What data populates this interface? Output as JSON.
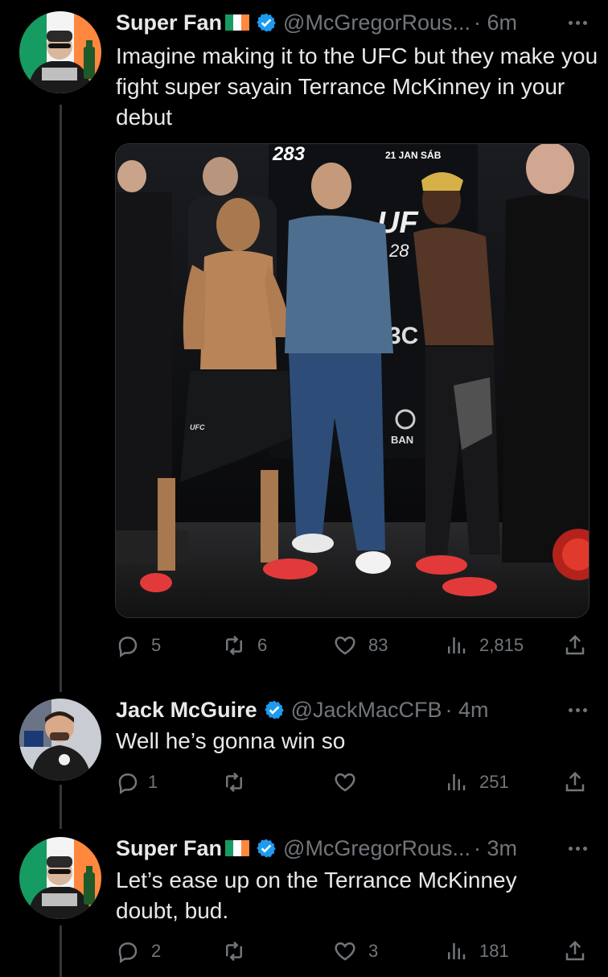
{
  "tweets": [
    {
      "name": "Super Fan",
      "handle": "@McGregorRous...",
      "time": "· 6m",
      "text": "Imagine making it to the UFC but they make you fight super sayain Terrance McKinney in your debut",
      "stats": {
        "replies": "5",
        "retweets": "6",
        "likes": "83",
        "views": "2,815"
      },
      "media": {
        "overlay_1": "283",
        "overlay_2": "21 JAN SÁB",
        "overlay_3": "UF",
        "overlay_4": "28",
        "overlay_5": "3C",
        "overlay_6": "BAN",
        "overlay_7": "UFC"
      }
    },
    {
      "name": "Jack McGuire",
      "handle": "@JackMacCFB",
      "time": "· 4m",
      "text": "Well he’s gonna win so",
      "stats": {
        "replies": "1",
        "retweets": "",
        "likes": "",
        "views": "251"
      }
    },
    {
      "name": "Super Fan",
      "handle": "@McGregorRous...",
      "time": "· 3m",
      "text": "Let’s ease up on the Terrance McKinney doubt, bud.",
      "stats": {
        "replies": "2",
        "retweets": "",
        "likes": "3",
        "views": "181"
      }
    }
  ],
  "colors": {
    "bg": "#000000",
    "text": "#e7e9ea",
    "muted": "#71767b",
    "verified": "#1d9bf0",
    "flag_green": "#169b62",
    "flag_orange": "#ff883e"
  },
  "icons": [
    "verified-badge-icon",
    "ireland-flag-icon",
    "more-icon",
    "reply-icon",
    "retweet-icon",
    "like-icon",
    "views-icon",
    "share-icon"
  ]
}
